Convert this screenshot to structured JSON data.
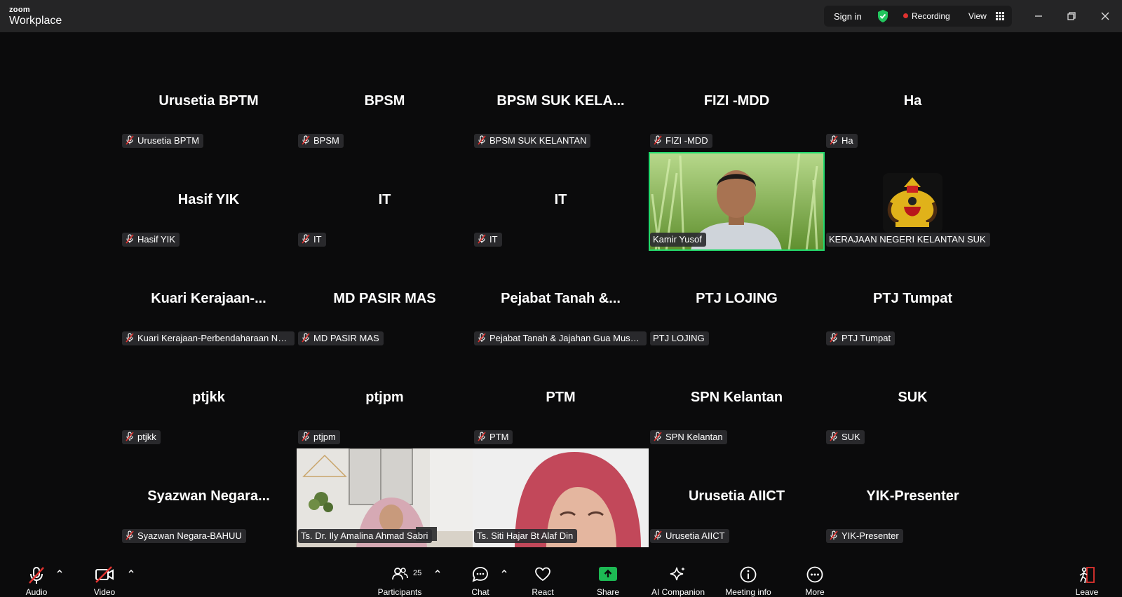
{
  "app": {
    "brand_small": "zoom",
    "brand_large": "Workplace"
  },
  "titlebar": {
    "sign_in": "Sign in",
    "recording": "Recording",
    "view": "View",
    "colors": {
      "shield": "#22c55e",
      "rec": "#e0322f"
    }
  },
  "gallery": {
    "tiles": [
      {
        "big": "Urusetia BPTM",
        "tag": "Urusetia BPTM",
        "muted": true
      },
      {
        "big": "BPSM",
        "tag": "BPSM",
        "muted": true
      },
      {
        "big": "BPSM  SUK KELA...",
        "tag": "BPSM SUK KELANTAN",
        "muted": true
      },
      {
        "big": "FIZI -MDD",
        "tag": "FIZI -MDD",
        "muted": true
      },
      {
        "big": "Ha",
        "tag": "Ha",
        "muted": true
      },
      {
        "big": "Hasif YIK",
        "tag": "Hasif YIK",
        "muted": true
      },
      {
        "big": "IT",
        "tag": "IT",
        "muted": true
      },
      {
        "big": "IT",
        "tag": "IT",
        "muted": true
      },
      {
        "big": "",
        "tag": "Kamir Yusof",
        "muted": false,
        "video": "man"
      },
      {
        "big": "",
        "tag": "KERAJAAN NEGERI KELANTAN SUK",
        "muted": false,
        "video": "crest"
      },
      {
        "big": "Kuari  Kerajaan-...",
        "tag": "Kuari Kerajaan-Perbendaharaan Neg...",
        "muted": true
      },
      {
        "big": "MD PASIR MAS",
        "tag": "MD PASIR MAS",
        "muted": true
      },
      {
        "big": "Pejabat Tanah &...",
        "tag": "Pejabat Tanah & Jajahan Gua Musang",
        "muted": true
      },
      {
        "big": "PTJ LOJING",
        "tag": "PTJ LOJING",
        "muted": false
      },
      {
        "big": "PTJ Tumpat",
        "tag": "PTJ Tumpat",
        "muted": true
      },
      {
        "big": "ptjkk",
        "tag": "ptjkk",
        "muted": true
      },
      {
        "big": "ptjpm",
        "tag": "ptjpm",
        "muted": true
      },
      {
        "big": "PTM",
        "tag": "PTM",
        "muted": true
      },
      {
        "big": "SPN Kelantan",
        "tag": "SPN Kelantan",
        "muted": true
      },
      {
        "big": "SUK",
        "tag": "SUK",
        "muted": true
      },
      {
        "big": "Syazwan  Negara...",
        "tag": "Syazwan Negara-BAHUU",
        "muted": true
      },
      {
        "big": "",
        "tag": "Ts. Dr. Ily Amalina Ahmad Sabri",
        "muted": false,
        "video": "office"
      },
      {
        "big": "",
        "tag": "Ts. Siti Hajar Bt Alaf Din",
        "muted": false,
        "video": "closeup"
      },
      {
        "big": "Urusetia AIICT",
        "tag": "Urusetia AIICT",
        "muted": true
      },
      {
        "big": "YIK-Presenter",
        "tag": "YIK-Presenter",
        "muted": true
      }
    ]
  },
  "toolbar": {
    "audio": "Audio",
    "video": "Video",
    "participants": "Participants",
    "participants_count": "25",
    "chat": "Chat",
    "react": "React",
    "share": "Share",
    "ai_companion": "AI Companion",
    "meeting_info": "Meeting info",
    "more": "More",
    "leave": "Leave",
    "colors": {
      "share": "#1db954",
      "mute": "#e0322f"
    }
  }
}
